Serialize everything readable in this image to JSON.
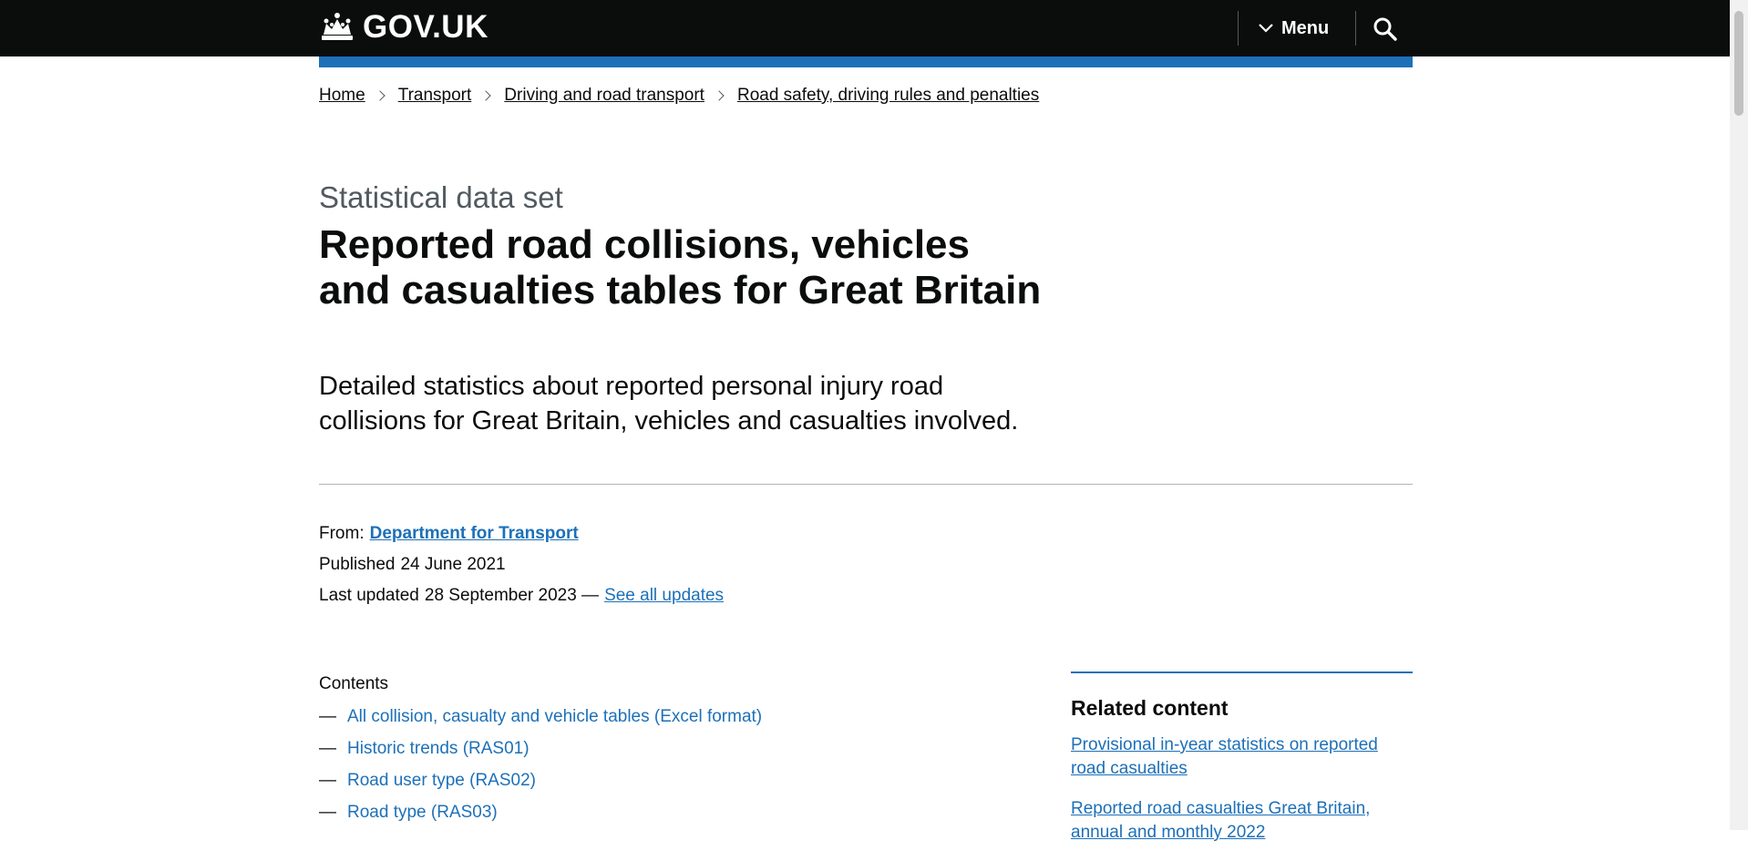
{
  "header": {
    "logo_text": "GOV.UK",
    "menu_label": "Menu",
    "search_icon": "search-icon",
    "colors": {
      "header_bg": "#0b0c0c",
      "accent": "#1d70b8"
    }
  },
  "breadcrumb": [
    {
      "label": "Home"
    },
    {
      "label": "Transport"
    },
    {
      "label": "Driving and road transport"
    },
    {
      "label": "Road safety, driving rules and penalties"
    }
  ],
  "page": {
    "caption": "Statistical data set",
    "title": "Reported road collisions, vehicles and casualties tables for Great Britain",
    "lead": "Detailed statistics about reported personal injury road collisions for Great Britain, vehicles and casualties involved."
  },
  "metadata": {
    "from_label": "From:",
    "organisation": "Department for Transport",
    "published_label": "Published",
    "published_date": "24 June 2021",
    "updated_label": "Last updated",
    "updated_date": "28 September 2023 —",
    "see_all_updates": "See all updates"
  },
  "contents": {
    "heading": "Contents",
    "dash": "—",
    "items": [
      "All collision, casualty and vehicle tables (Excel format)",
      "Historic trends (RAS01)",
      "Road user type (RAS02)",
      "Road type (RAS03)"
    ]
  },
  "related": {
    "heading": "Related content",
    "links": [
      "Provisional in-year statistics on reported road casualties",
      "Reported road casualties Great Britain, annual and monthly 2022"
    ]
  }
}
